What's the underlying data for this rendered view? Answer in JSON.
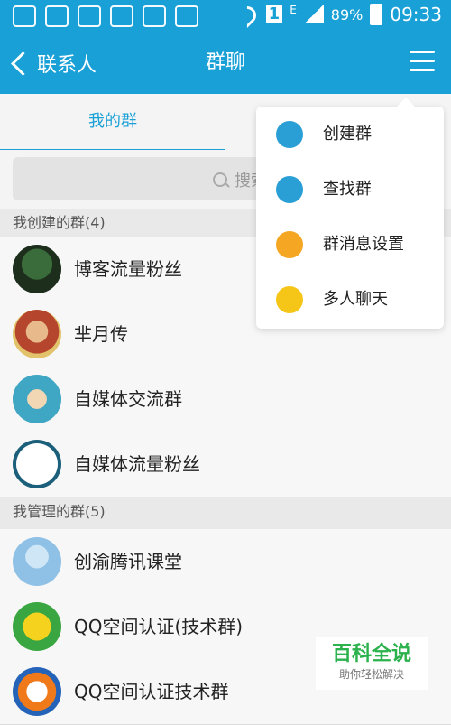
{
  "statusbar": {
    "signal_label": "E",
    "battery": "89%",
    "time": "09:33",
    "sim": "1"
  },
  "navbar": {
    "back_label": "联系人",
    "title": "群聊"
  },
  "tabs": [
    {
      "label": "我的群"
    }
  ],
  "search": {
    "placeholder": "搜索"
  },
  "sections": {
    "created": {
      "label": "我创建的群(4)"
    },
    "managed": {
      "label": "我管理的群(5)"
    }
  },
  "groups": [
    {
      "name": "博客流量粉丝"
    },
    {
      "name": "芈月传"
    },
    {
      "name": "自媒体交流群"
    },
    {
      "name": "自媒体流量粉丝"
    },
    {
      "name": "创渝腾讯课堂"
    },
    {
      "name": "QQ空间认证(技术群)"
    },
    {
      "name": "QQ空间认证技术群"
    }
  ],
  "menu": [
    {
      "label": "创建群",
      "icon": "create-group-icon"
    },
    {
      "label": "查找群",
      "icon": "find-group-icon"
    },
    {
      "label": "群消息设置",
      "icon": "gear-icon"
    },
    {
      "label": "多人聊天",
      "icon": "chat-add-icon"
    }
  ],
  "watermark": {
    "main": "百科全说",
    "sub": "助你轻松解决"
  },
  "colors": {
    "accent": "#19a0d6",
    "menu_icon": "#2a9fd6",
    "gear": "#f5a623",
    "chat": "#f5c518"
  }
}
